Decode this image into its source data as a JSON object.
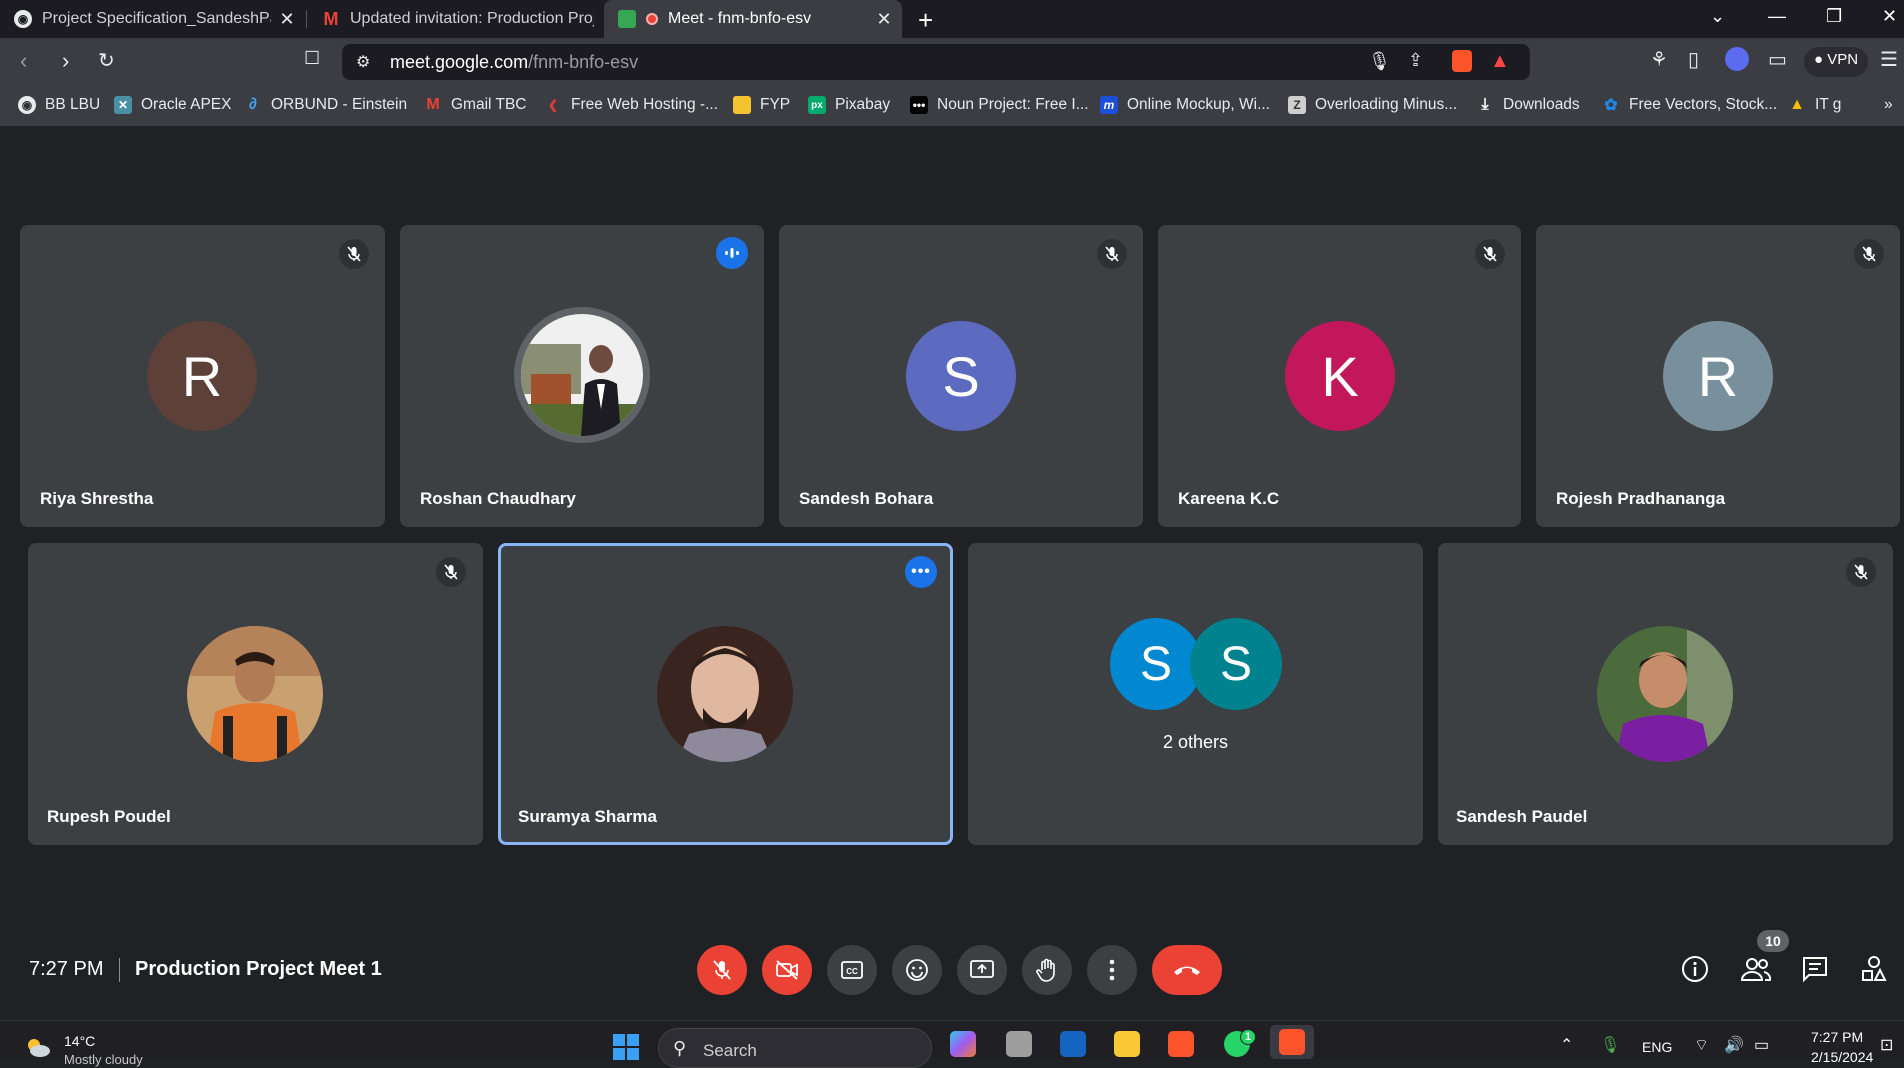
{
  "browser": {
    "tabs": [
      {
        "title": "Project Specification_SandeshPaudel",
        "active": false
      },
      {
        "title": "Updated invitation: Production Project",
        "active": false
      },
      {
        "title": "Meet - fnm-bnfo-esv",
        "active": true
      }
    ],
    "url_host": "meet.google.com",
    "url_path": "/fnm-bnfo-esv",
    "vpn_label": "VPN",
    "bookmarks": [
      "BB LBU",
      "Oracle APEX",
      "ORBUND - Einstein",
      "Gmail TBC",
      "Free Web Hosting -...",
      "FYP",
      "Pixabay",
      "Noun Project: Free I...",
      "Online Mockup, Wi...",
      "Overloading Minus...",
      "Downloads",
      "Free Vectors, Stock...",
      "IT g"
    ]
  },
  "meet": {
    "participants": [
      {
        "name": "Riya Shrestha",
        "initial": "R",
        "color": "#5d4037",
        "muted": true
      },
      {
        "name": "Roshan Chaudhary",
        "initial": "",
        "color": "#2b3a2e",
        "speaking": true
      },
      {
        "name": "Sandesh Bohara",
        "initial": "S",
        "color": "#5c6bc0",
        "muted": true
      },
      {
        "name": "Kareena K.C",
        "initial": "K",
        "color": "#c2185b",
        "muted": true
      },
      {
        "name": "Rojesh Pradhananga",
        "initial": "R",
        "color": "#78909c",
        "muted": true
      },
      {
        "name": "Rupesh Poudel",
        "initial": "",
        "color": "#e67e22",
        "muted": true
      },
      {
        "name": "Suramya Sharma",
        "initial": "",
        "color": "#6d4c41",
        "selected": true
      },
      {
        "name": "Sandesh Paudel",
        "initial": "",
        "color": "#6a1b9a",
        "muted": true
      }
    ],
    "others": {
      "label": "2 others",
      "initials": [
        "S",
        "S"
      ],
      "colors": [
        "#0288d1",
        "#00838f"
      ]
    },
    "time": "7:27 PM",
    "meeting_title": "Production Project Meet 1",
    "people_count": "10"
  },
  "taskbar": {
    "temperature": "14°C",
    "weather": "Mostly cloudy",
    "search_placeholder": "Search",
    "whatsapp_badge": "1",
    "language": "ENG",
    "time": "7:27 PM",
    "date": "2/15/2024"
  }
}
